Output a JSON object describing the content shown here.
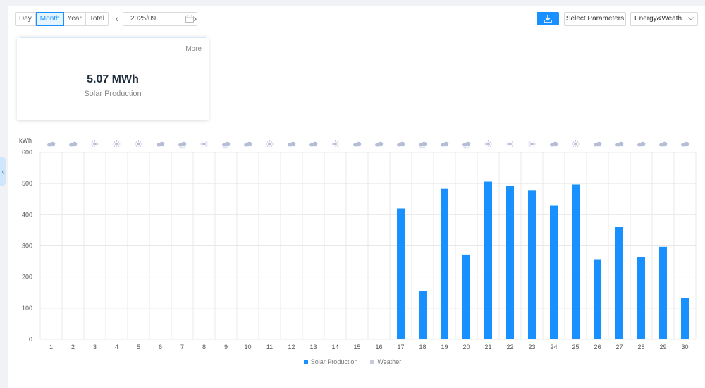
{
  "toolbar": {
    "periods": [
      "Day",
      "Month",
      "Year",
      "Total"
    ],
    "active_period": "Month",
    "date": "2025/09",
    "select_parameters": "Select Parameters",
    "view_select": "Energy&Weath..."
  },
  "summary_card": {
    "more": "More",
    "value": "5.07 MWh",
    "label": "Solar Production"
  },
  "colors": {
    "bar": "#1890ff",
    "weather_icon": "#b6bdd6",
    "grid": "#e8e8e8",
    "accent": "#1890ff"
  },
  "chart_data": {
    "type": "bar",
    "ylabel": "kWh",
    "ylim": [
      0,
      600
    ],
    "yticks": [
      0,
      100,
      200,
      300,
      400,
      500,
      600
    ],
    "categories": [
      "1",
      "2",
      "3",
      "4",
      "5",
      "6",
      "7",
      "8",
      "9",
      "10",
      "11",
      "12",
      "13",
      "14",
      "15",
      "16",
      "17",
      "18",
      "19",
      "20",
      "21",
      "22",
      "23",
      "24",
      "25",
      "26",
      "27",
      "28",
      "29",
      "30"
    ],
    "series": [
      {
        "name": "Solar Production",
        "values": [
          0,
          0,
          0,
          0,
          0,
          0,
          0,
          0,
          0,
          0,
          0,
          0,
          0,
          0,
          0,
          0,
          420,
          155,
          483,
          272,
          506,
          492,
          477,
          429,
          497,
          257,
          360,
          264,
          297,
          132
        ]
      }
    ],
    "weather": [
      "cloud",
      "cloud",
      "sun",
      "sun",
      "sun",
      "cloud",
      "rain",
      "sun",
      "rain",
      "cloud",
      "sun",
      "cloud",
      "cloud",
      "sun",
      "cloud",
      "cloud",
      "cloud",
      "rain",
      "cloud",
      "rain",
      "sun",
      "sun",
      "sun",
      "cloud",
      "sun",
      "cloud",
      "cloud",
      "cloud",
      "cloud",
      "cloud"
    ],
    "legend": [
      {
        "name": "Solar Production",
        "color": "#1890ff"
      },
      {
        "name": "Weather",
        "color": "#c5c9dd"
      }
    ],
    "grid": true
  }
}
